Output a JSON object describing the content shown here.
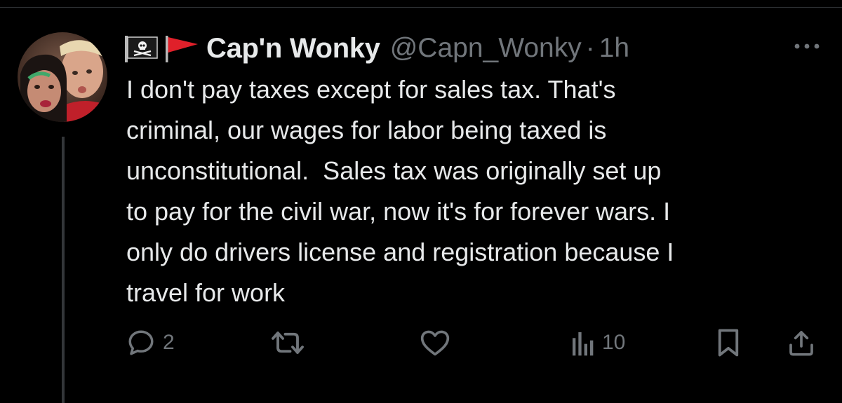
{
  "tweet": {
    "author": {
      "display_name": "Cap'n Wonky",
      "handle": "@Capn_Wonky",
      "name_prefix_icons": [
        "pirate-flag-icon",
        "red-triangular-flag-icon"
      ],
      "avatar_alt": "profile photo"
    },
    "separator": "·",
    "timestamp": "1h",
    "text": "I don't pay taxes except for sales tax. That's\ncriminal, our wages for labor being taxed is\nunconstitutional.  Sales tax was originally set up\nto pay for the civil war, now it's for forever wars. I\nonly do drivers license and registration because I\ntravel for work",
    "actions": {
      "reply_count": "2",
      "retweet_count": "",
      "like_count": "",
      "views_count": "10"
    }
  },
  "icons": {
    "reply": "reply-icon",
    "retweet": "retweet-icon",
    "like": "heart-icon",
    "views": "views-chart-icon",
    "bookmark": "bookmark-icon",
    "share": "share-icon",
    "more": "more-icon"
  },
  "colors": {
    "background": "#000000",
    "primary_text": "#e7e9ea",
    "secondary_text": "#71767b",
    "thread_line": "#333639",
    "flag_red": "#e0202a"
  }
}
